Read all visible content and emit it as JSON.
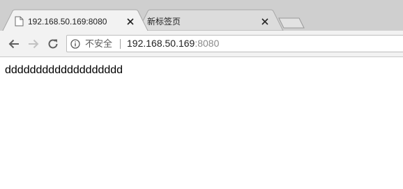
{
  "tabs": [
    {
      "title": "192.168.50.169:8080",
      "active": true,
      "icon": "page-icon"
    },
    {
      "title": "新标签页",
      "active": false
    }
  ],
  "toolbar": {
    "back_icon": "arrow-left-icon",
    "forward_icon": "arrow-right-icon",
    "reload_icon": "reload-icon"
  },
  "omnibox": {
    "security_icon": "info-icon",
    "security_label": "不安全",
    "url_host": "192.168.50.169",
    "url_port": ":8080"
  },
  "page": {
    "text": "ddddddddddddddddddd"
  },
  "colors": {
    "tabstrip": "#cfcfcf",
    "active_tab": "#f2f2f2",
    "inactive_tab": "#dcdcdc",
    "url_port": "#8a8a8a"
  }
}
